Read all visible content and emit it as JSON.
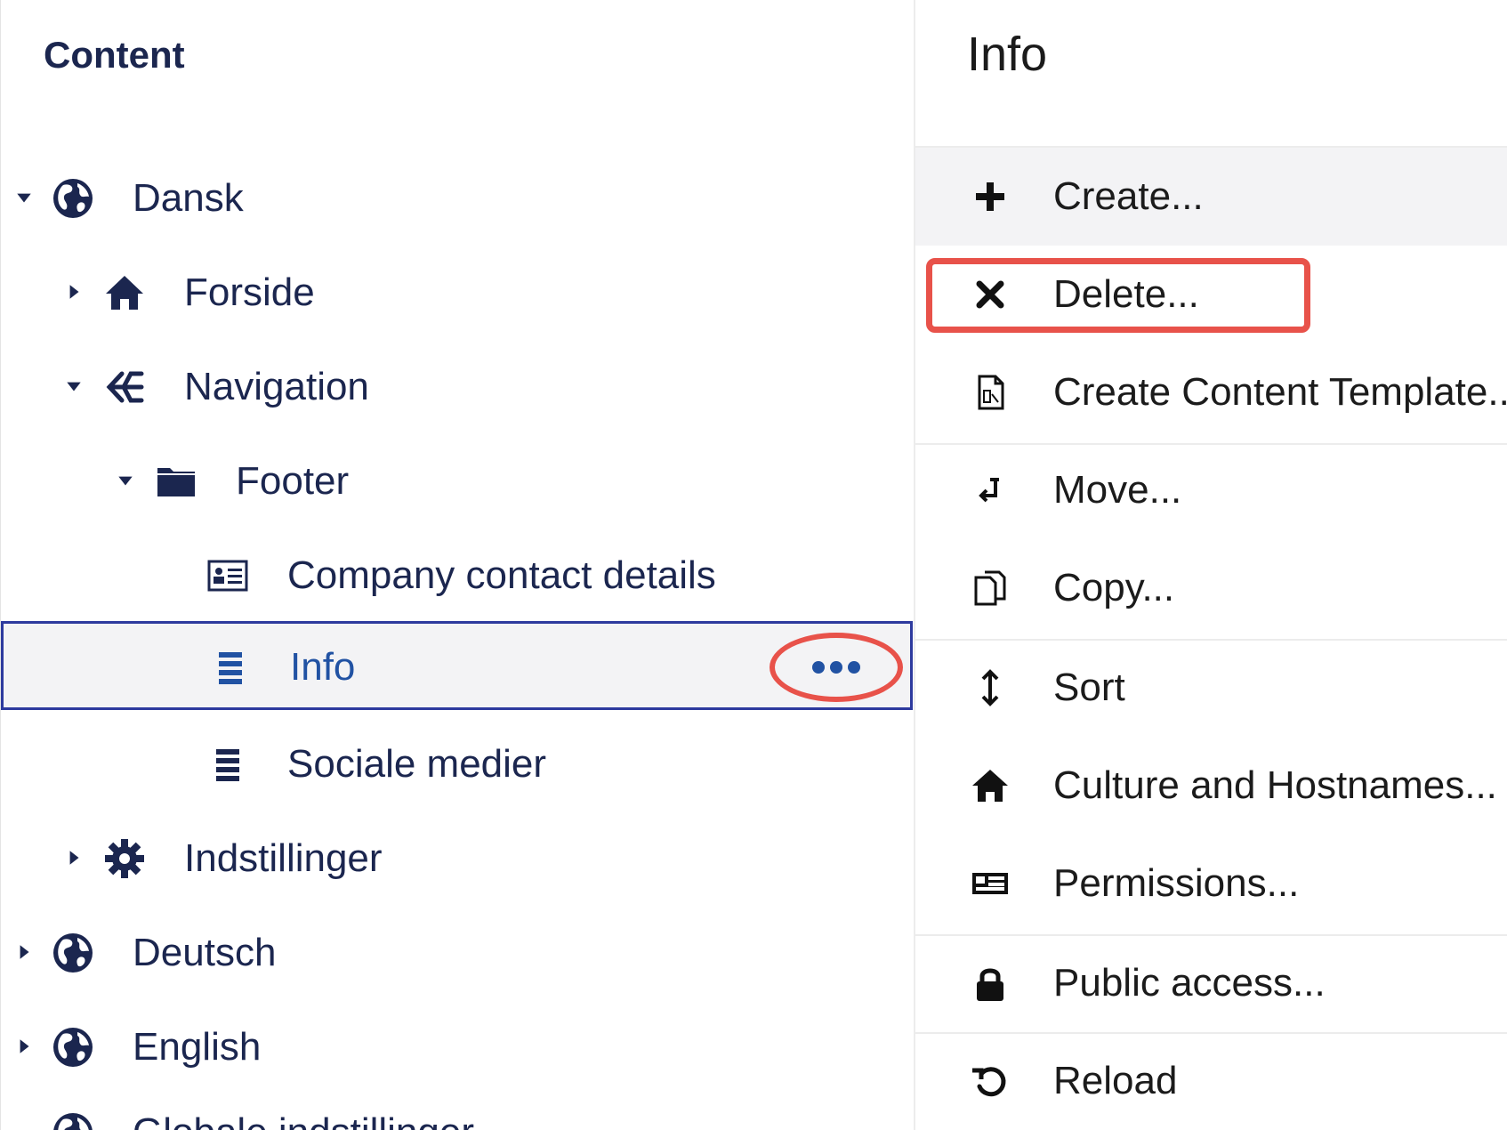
{
  "tree": {
    "title": "Content",
    "items": [
      {
        "label": "Dansk",
        "icon": "globe-icon",
        "caret": "expanded"
      },
      {
        "label": "Forside",
        "icon": "home-icon",
        "caret": "collapsed"
      },
      {
        "label": "Navigation",
        "icon": "sitemap-icon",
        "caret": "expanded"
      },
      {
        "label": "Footer",
        "icon": "folder-icon",
        "caret": "expanded"
      },
      {
        "label": "Company contact details",
        "icon": "contact-card-icon",
        "caret": "none"
      },
      {
        "label": "Info",
        "icon": "list-icon",
        "caret": "none",
        "selected": true
      },
      {
        "label": "Sociale medier",
        "icon": "list-icon",
        "caret": "none"
      },
      {
        "label": "Indstillinger",
        "icon": "gear-icon",
        "caret": "collapsed"
      },
      {
        "label": "Deutsch",
        "icon": "globe-icon",
        "caret": "collapsed"
      },
      {
        "label": "English",
        "icon": "globe-icon",
        "caret": "collapsed"
      },
      {
        "label": "Globale indstillinger",
        "icon": "globe-icon",
        "caret": "none"
      }
    ],
    "selected_more_icon": "ellipsis-icon"
  },
  "actions": {
    "title": "Info",
    "items": [
      {
        "label": "Create...",
        "icon": "plus-icon"
      },
      {
        "label": "Delete...",
        "icon": "close-icon"
      },
      {
        "label": "Create Content Template...",
        "icon": "document-icon"
      },
      {
        "label": "Move...",
        "icon": "move-icon"
      },
      {
        "label": "Copy...",
        "icon": "copy-icon"
      },
      {
        "label": "Sort",
        "icon": "sort-icon"
      },
      {
        "label": "Culture and Hostnames...",
        "icon": "home-icon"
      },
      {
        "label": "Permissions...",
        "icon": "permissions-icon"
      },
      {
        "label": "Public access...",
        "icon": "lock-icon"
      },
      {
        "label": "Reload",
        "icon": "reload-icon"
      }
    ]
  },
  "colors": {
    "tree_text": "#1b264f",
    "selected_text": "#2152a3",
    "selected_border": "#2d3a9e",
    "annotation_red": "#e8524a"
  }
}
